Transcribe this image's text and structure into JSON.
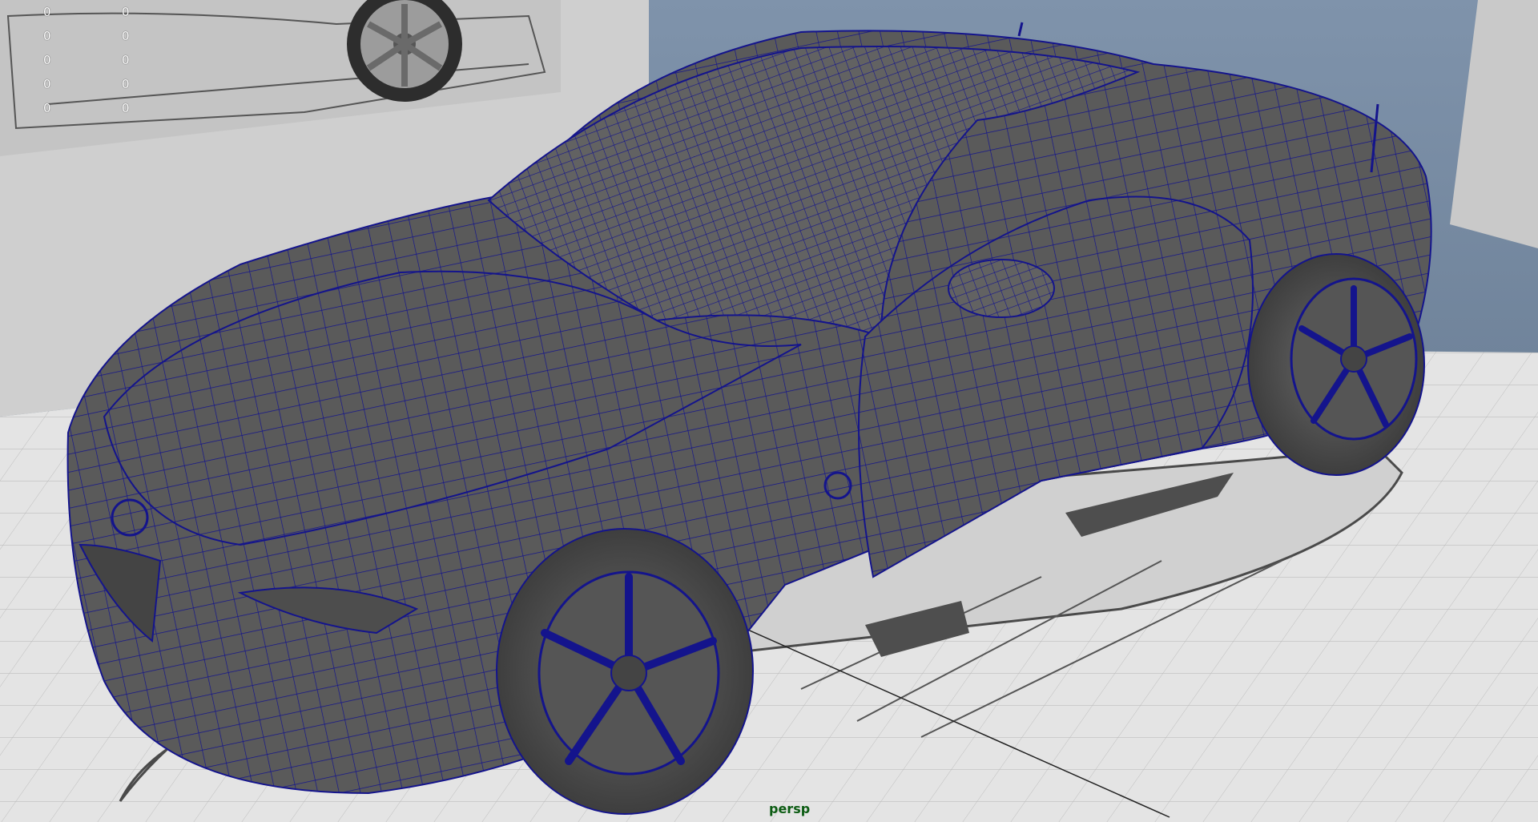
{
  "viewport": {
    "camera": "persp",
    "hud": {
      "column_a": [
        "0",
        "0",
        "0",
        "0",
        "0"
      ],
      "column_b": [
        "0",
        "0",
        "0",
        "0",
        "0"
      ]
    }
  },
  "colors": {
    "background_gradient_top": "#7f93ab",
    "background_gradient_bottom": "#5d7086",
    "mesh_fill": "#5a5a5a",
    "wireframe": "#14148c",
    "camera_label": "#0b5b12",
    "hud_text": "#ffffff",
    "ground_plane": "#e6e6e6"
  },
  "icons": {
    "car_model": "car-mesh-icon",
    "reference_image": "reference-image-icon"
  }
}
